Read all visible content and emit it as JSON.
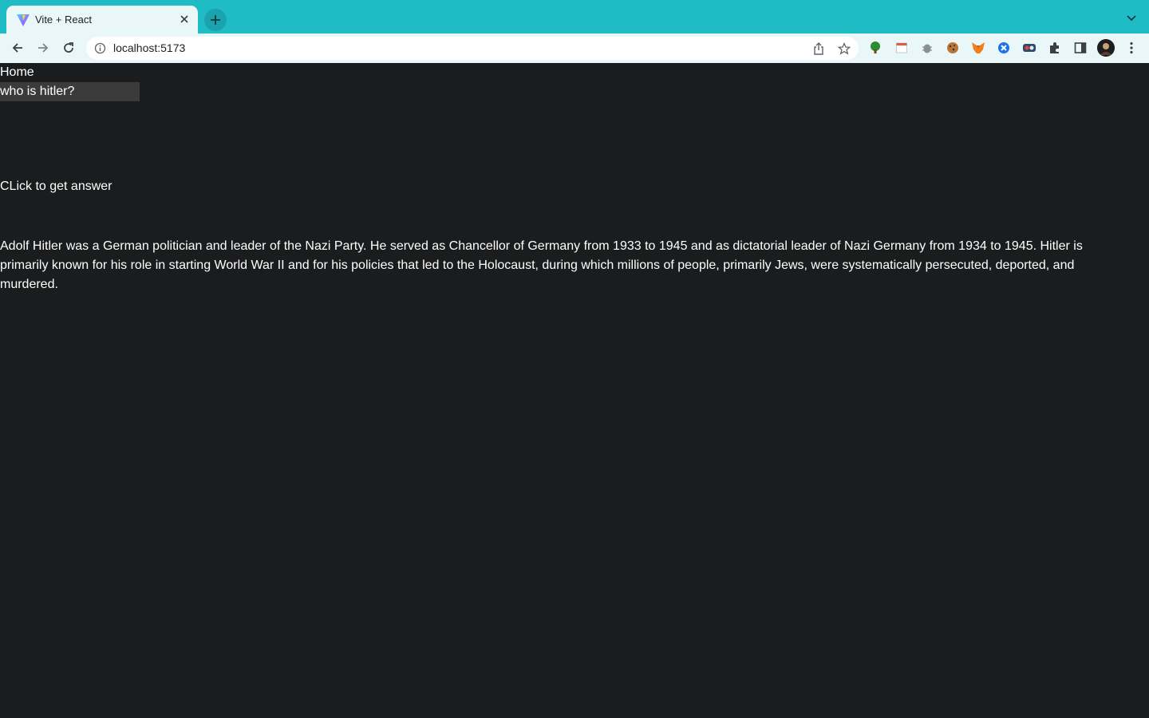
{
  "browser": {
    "tab": {
      "title": "Vite + React"
    },
    "address": {
      "url": "localhost:5173"
    },
    "colors": {
      "tabstrip": "#20bcc6",
      "toolbar": "#eaf7f8",
      "page_bg": "#1a1c1d"
    },
    "icons": [
      "back-icon",
      "forward-icon",
      "reload-icon",
      "info-icon",
      "share-icon",
      "star-icon",
      "extensions-icon",
      "side-panel-icon",
      "more-icon"
    ]
  },
  "app": {
    "nav": {
      "home": "Home"
    },
    "question_input": {
      "value": "who is hitler?"
    },
    "button_label": "CLick to get answer",
    "answer": "Adolf Hitler was a German politician and leader of the Nazi Party. He served as Chancellor of Germany from 1933 to 1945 and as dictatorial leader of Nazi Germany from 1934 to 1945. Hitler is primarily known for his role in starting World War II and for his policies that led to the Holocaust, during which millions of people, primarily Jews, were systematically persecuted, deported, and murdered."
  }
}
